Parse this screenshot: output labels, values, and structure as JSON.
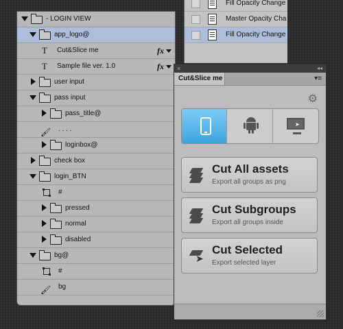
{
  "layers": {
    "rows": [
      {
        "label": "- LOGIN VIEW"
      },
      {
        "label": "app_logo@"
      },
      {
        "label": "Cut&Slice me",
        "fx": "fx"
      },
      {
        "label": "Sample file ver. 1.0",
        "fx": "fx"
      },
      {
        "label": "user input"
      },
      {
        "label": "pass input"
      },
      {
        "label": "pass_title@"
      },
      {
        "label": ". . . ."
      },
      {
        "label": "loginbox@"
      },
      {
        "label": "check box"
      },
      {
        "label": "login_BTN"
      },
      {
        "label": "#"
      },
      {
        "label": "pressed"
      },
      {
        "label": "normal"
      },
      {
        "label": "disabled"
      },
      {
        "label": "bg@"
      },
      {
        "label": "#"
      },
      {
        "label": "bg"
      }
    ],
    "type_icon": "T"
  },
  "history": {
    "rows": [
      {
        "label": "Fill Opacity Change"
      },
      {
        "label": "Master Opacity Cha"
      },
      {
        "label": "Fill Opacity Change"
      }
    ]
  },
  "plugin": {
    "tab_title": "Cut&Slice me",
    "close_glyph": "×",
    "collapse_glyph": "◂◂",
    "menu_glyph": "▾≡",
    "gear_glyph": "⚙",
    "platforms": [
      "iOS",
      "Android",
      "Desktop"
    ],
    "selected_platform": "iOS",
    "actions": [
      {
        "title": "Cut All assets",
        "subtitle": "Export all groups as png"
      },
      {
        "title": "Cut Subgroups",
        "subtitle": "Export all groups inside"
      },
      {
        "title": "Cut Selected",
        "subtitle": "Export selected layer"
      }
    ]
  },
  "colors": {
    "selection": "#aebdd9",
    "active_platform": "#3fa4df",
    "panel": "#bcbcbc"
  }
}
